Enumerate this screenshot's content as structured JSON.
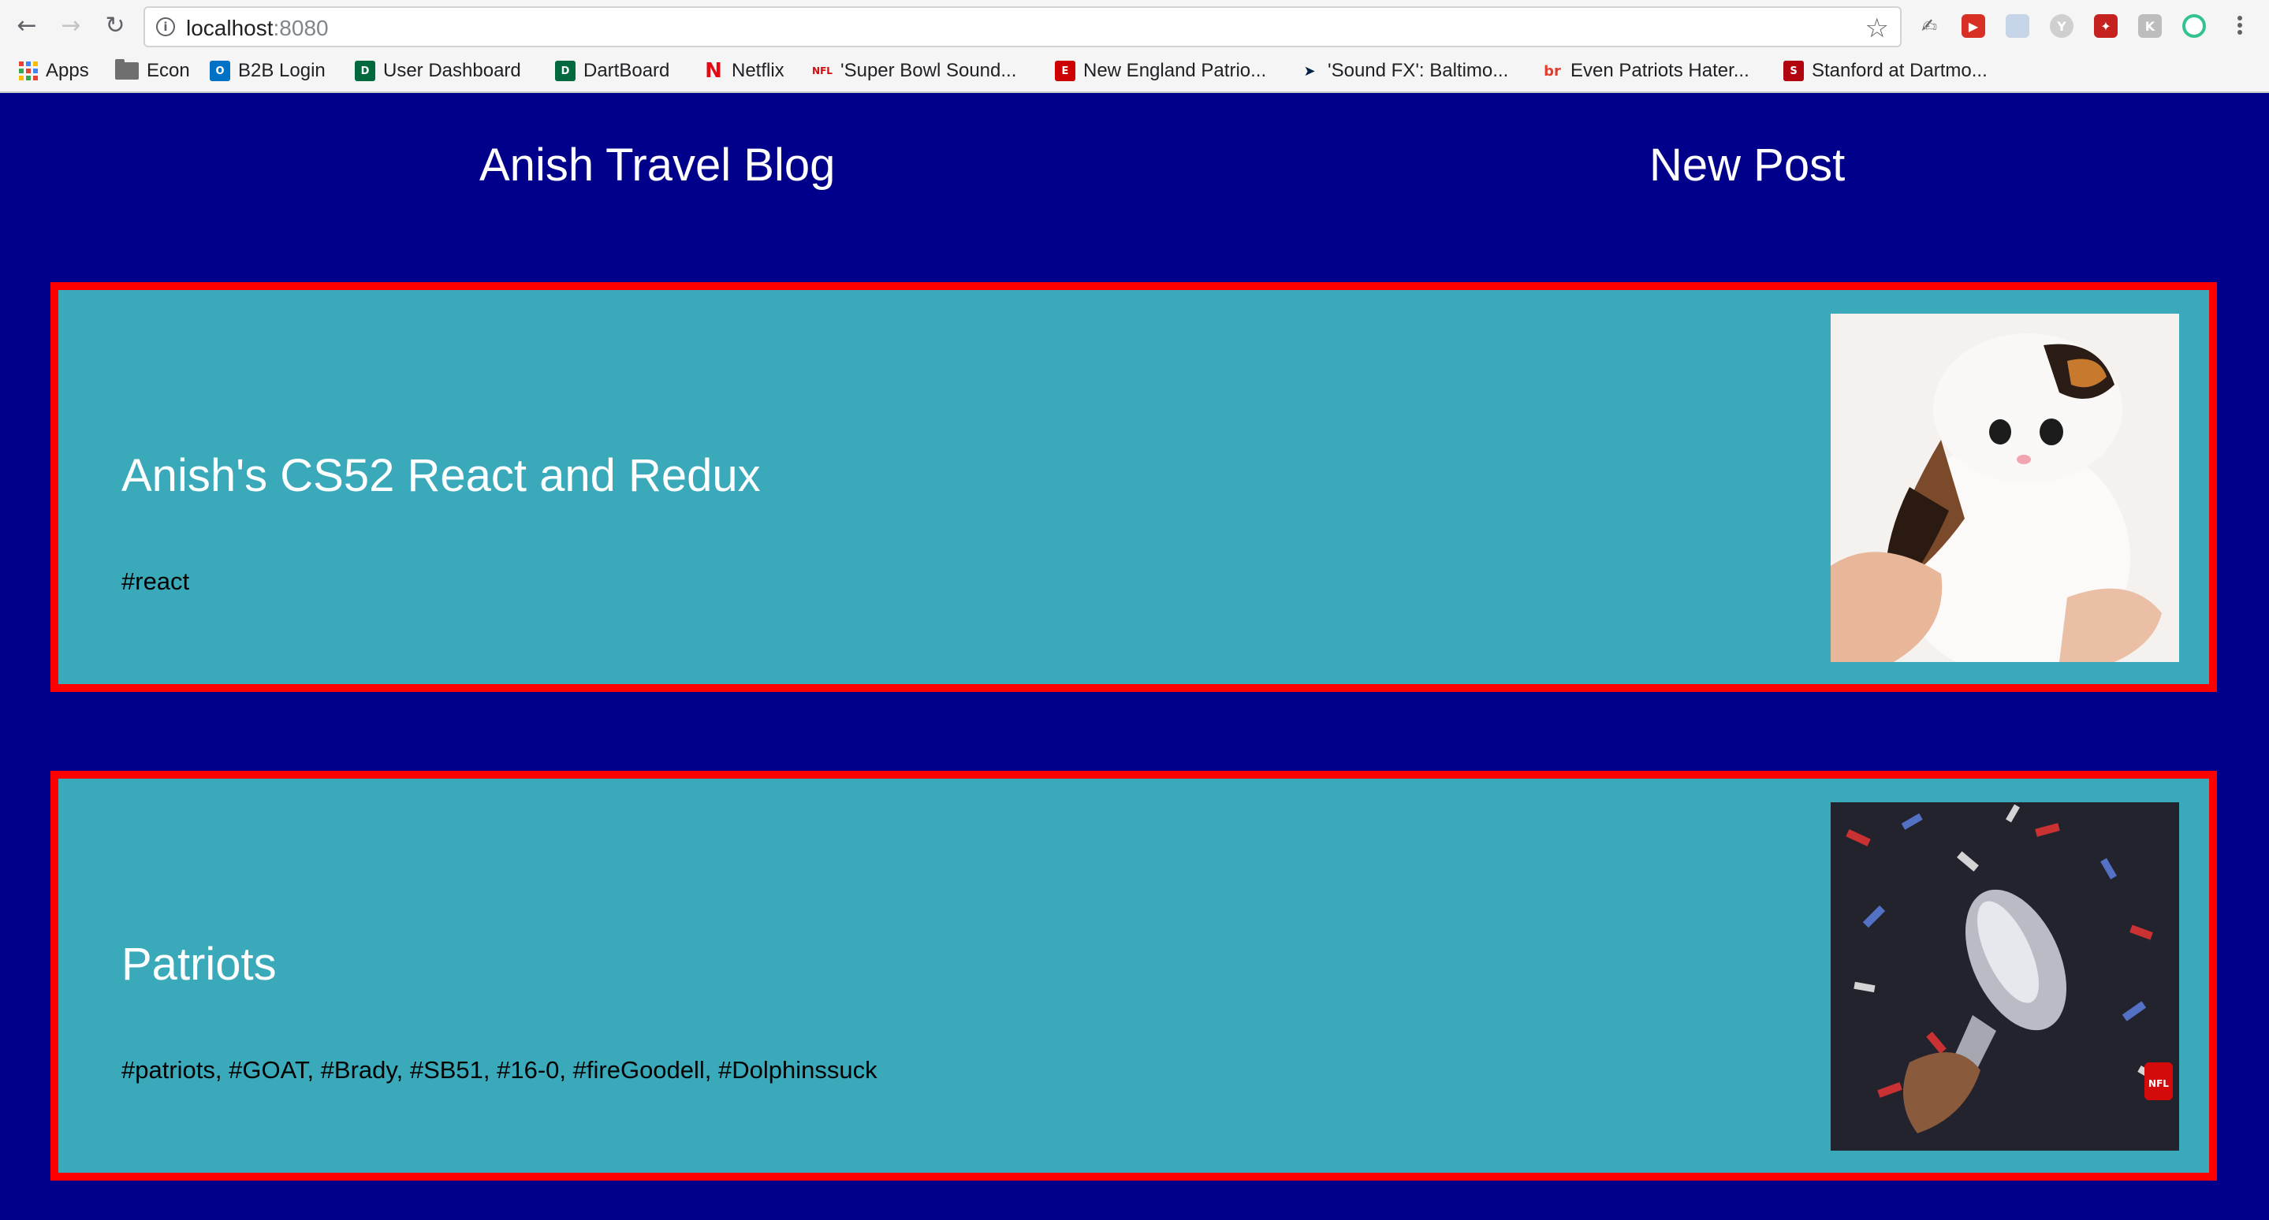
{
  "browser": {
    "url_host": "localhost",
    "url_port": ":8080",
    "back_icon": "arrow-left-icon",
    "forward_icon": "arrow-right-icon",
    "reload_icon": "reload-icon",
    "bookmark_star_icon": "star-icon",
    "extension_icons": [
      "pen-icon",
      "red-play-icon",
      "photo-icon",
      "y-icon",
      "red-puzzle-icon",
      "gray-k-icon",
      "green-ring-icon"
    ],
    "menu_icon": "kebab-menu-icon"
  },
  "bookmarks": [
    {
      "label": "Apps",
      "icon": "apps-grid-icon"
    },
    {
      "label": "Econ",
      "icon": "folder-icon"
    },
    {
      "label": "B2B Login",
      "icon": "outlook-icon"
    },
    {
      "label": "User Dashboard",
      "icon": "dartmouth-d-icon"
    },
    {
      "label": "DartBoard",
      "icon": "dartmouth-d-icon"
    },
    {
      "label": "Netflix",
      "icon": "netflix-icon"
    },
    {
      "label": "'Super Bowl Sound...",
      "icon": "nfl-icon"
    },
    {
      "label": "New England Patrio...",
      "icon": "espn-icon"
    },
    {
      "label": "'Sound FX': Baltimo...",
      "icon": "patriots-icon"
    },
    {
      "label": "Even Patriots Hater...",
      "icon": "bleacher-report-icon"
    },
    {
      "label": "Stanford at Dartmo...",
      "icon": "stanford-s-icon"
    }
  ],
  "header": {
    "title": "Anish Travel Blog",
    "new_post": "New Post"
  },
  "posts": [
    {
      "title": "Anish's CS52 React and Redux",
      "tags": "#react",
      "image": "kitten-image"
    },
    {
      "title": "Patriots",
      "tags": "#patriots, #GOAT, #Brady, #SB51, #16-0, #fireGoodell, #Dolphinssuck",
      "image": "trophy-image"
    }
  ],
  "colors": {
    "page_background": "#00008b",
    "card_background": "#3aaabb",
    "card_border": "#ff0000",
    "heading_text": "#ffffff"
  }
}
